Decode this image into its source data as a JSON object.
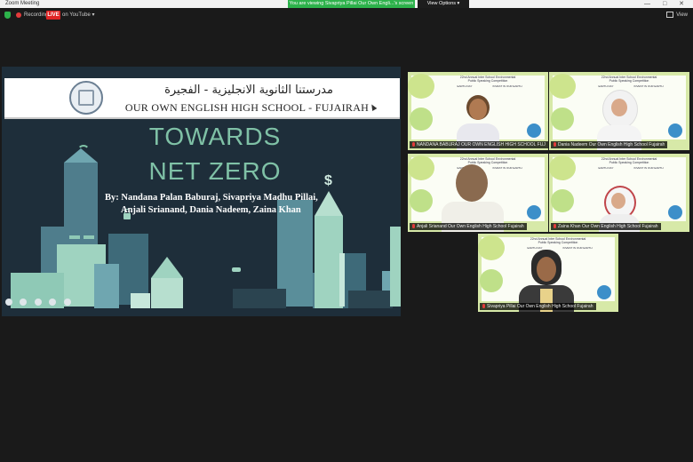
{
  "window": {
    "title": "Zoom Meeting",
    "controls": "— □ ✕"
  },
  "banner": {
    "viewing": "You are viewing Sivapriya Pillai Our Own Engli...'s screen",
    "view_options": "View Options ▾"
  },
  "topbar": {
    "recording_label": "Recording",
    "live_label": "LIVE",
    "youtube_label": "on YouTube ▾",
    "view_label": "View"
  },
  "slide": {
    "arabic_name": "مدرستنا الثانوية الانجليزية - الفجيرة",
    "school_name": "OUR OWN ENGLISH HIGH SCHOOL - FUJAIRAH",
    "title_line1": "TOWARDS",
    "title_line2": "NET ZERO",
    "authors_line1": "By: Nandana Palan Baburaj, Sivapriya Madhu Pillai,",
    "authors_line2": "Anjali Srianand, Dania Nadeem, Zaina Khan",
    "dollar": "$"
  },
  "tile_header": {
    "line1": "22nd Annual Inter School Environmental",
    "line2": "Public Speaking Competition",
    "left": "EARTH DAY",
    "right": "INVEST IN OUR EARTH"
  },
  "participants": [
    {
      "name": "NANDANA BABURAJ OUR OWN ENGLISH HIGH SCHOOL FUJ"
    },
    {
      "name": "Dania Nadeem Our Own English High School Fujairah"
    },
    {
      "name": "Anjali Srianand Our Own English High School Fujairah"
    },
    {
      "name": "Zaina Khan Our Own English High School Fujairah"
    },
    {
      "name": "Sivapriya Pillai Our Own English High School Fujairah"
    }
  ],
  "colors": {
    "accent_green": "#2db24b",
    "live_red": "#e02424",
    "slide_bg": "#1e2e3a",
    "slide_title": "#7fc1a6",
    "tile_bg": "#d7e9a8"
  }
}
